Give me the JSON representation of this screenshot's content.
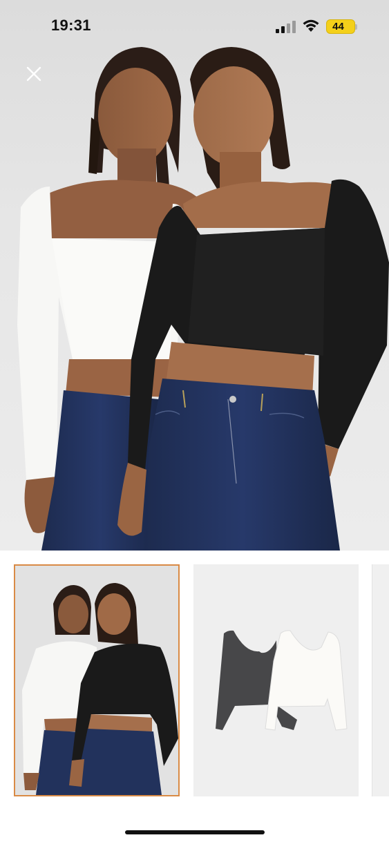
{
  "status_bar": {
    "time": "19:31",
    "battery_level": "44",
    "battery_color": "#f4d01a",
    "icons": [
      "cellular-signal-icon",
      "wifi-icon",
      "battery-icon"
    ]
  },
  "hero": {
    "image": "product-model-photo",
    "close_icon": "close-icon"
  },
  "thumbnails": [
    {
      "image": "thumbnail-models-photo",
      "selected": true,
      "selected_border_color": "#d98a45"
    },
    {
      "image": "thumbnail-flat-lay-tops"
    },
    {
      "image": "thumbnail-partial"
    }
  ],
  "colors": {
    "tee_white": "#f7f7f5",
    "tee_black": "#1a1a1a",
    "denim": "#1f2f55"
  }
}
